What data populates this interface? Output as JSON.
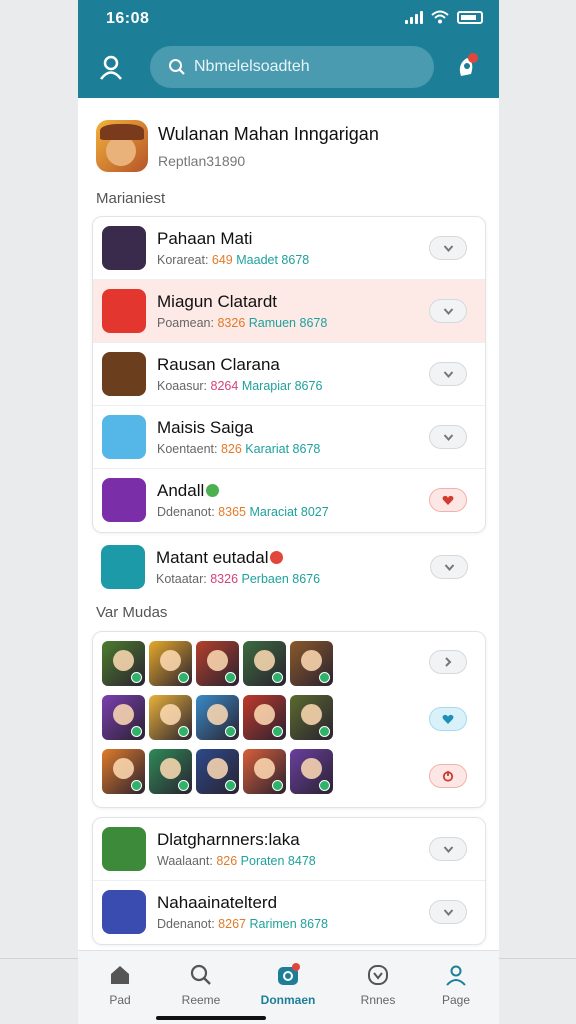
{
  "status": {
    "time": "16:08"
  },
  "search": {
    "placeholder": "Nbmelelsoadteh"
  },
  "hero": {
    "title": "Wulanan Mahan Inngarigan",
    "subtitle": "Reptlan31890"
  },
  "sections": {
    "first_label": "Marianiest",
    "second_label": "Var Mudas"
  },
  "list1": [
    {
      "title": "Pahaan Mati",
      "meta_prefix": "Korareat:",
      "meta_a": "649",
      "meta_b": "Maadet 8678",
      "icon_color": "#3a2a4c",
      "highlight": false,
      "pill": "neutral",
      "pill_icon": "chevron-down-icon"
    },
    {
      "title": "Miagun Clatardt",
      "meta_prefix": "Poamean:",
      "meta_a": "8326",
      "meta_b": "Ramuen 8678",
      "icon_color": "#e3362f",
      "highlight": true,
      "pill": "neutral",
      "pill_icon": "chevron-down-icon"
    },
    {
      "title": "Rausan Clarana",
      "meta_prefix": "Koaasur:",
      "meta_a": "8264",
      "meta_b": "Marapiar 8676",
      "icon_color": "#6b3e1d",
      "highlight": false,
      "pill": "neutral",
      "pill_icon": "chevron-down-icon"
    },
    {
      "title": "Maisis Saiga",
      "meta_prefix": "Koentaent:",
      "meta_a": "826",
      "meta_b": "Karariat 8678",
      "icon_color": "#54b7e8",
      "highlight": false,
      "pill": "neutral",
      "pill_icon": "chevron-down-icon"
    },
    {
      "title": "Andall",
      "meta_prefix": "Ddenanot:",
      "meta_a": "8365",
      "meta_b": "Maraciat 8027",
      "icon_color": "#7a2ea8",
      "highlight": false,
      "pill": "red",
      "pill_icon": "heart-icon",
      "badge_color": "#4caf50"
    }
  ],
  "single": {
    "title": "Matant eutadal",
    "meta_prefix": "Kotaatar:",
    "meta_a": "8326",
    "meta_b": "Perbaen 8676",
    "icon_color": "#1d9aa8",
    "badge_color": "#e2463a",
    "pill_icon": "chevron-down-icon"
  },
  "tiles": {
    "colors": [
      "#4d7d2e",
      "#e6a92b",
      "#b5402c",
      "#3d6b3f",
      "#8a5a2a",
      "#7b3fb0",
      "#e9b23a",
      "#3a8bc8",
      "#c0392b",
      "#5a6b2e",
      "#e07b2a",
      "#2e8b57",
      "#2c4a8a",
      "#d95f3a",
      "#6a3fa0"
    ]
  },
  "grid_pills": [
    {
      "style": "neutral",
      "icon": "chevron-right-icon"
    },
    {
      "style": "blue",
      "icon": "heart-icon"
    },
    {
      "style": "red",
      "icon": "power-icon"
    }
  ],
  "list2": [
    {
      "title": "Dlatgharnners:laka",
      "meta_prefix": "Waalaant:",
      "meta_a": "826",
      "meta_b": "Poraten 8478",
      "icon_color": "#3c8a3a",
      "pill_icon": "chevron-down-icon"
    },
    {
      "title": "Nahaainatelterd",
      "meta_prefix": "Ddenanot:",
      "meta_a": "8267",
      "meta_b": "Rarimen 8678",
      "icon_color": "#3a4cb0",
      "pill_icon": "chevron-down-icon"
    }
  ],
  "nav": [
    {
      "label": "Pad",
      "icon": "home-icon",
      "active": false
    },
    {
      "label": "Reeme",
      "icon": "search-icon",
      "active": false
    },
    {
      "label": "Donmaen",
      "icon": "download-icon",
      "active": true
    },
    {
      "label": "Rnnes",
      "icon": "games-icon",
      "active": false
    },
    {
      "label": "Page",
      "icon": "profile-icon",
      "active": false
    }
  ]
}
